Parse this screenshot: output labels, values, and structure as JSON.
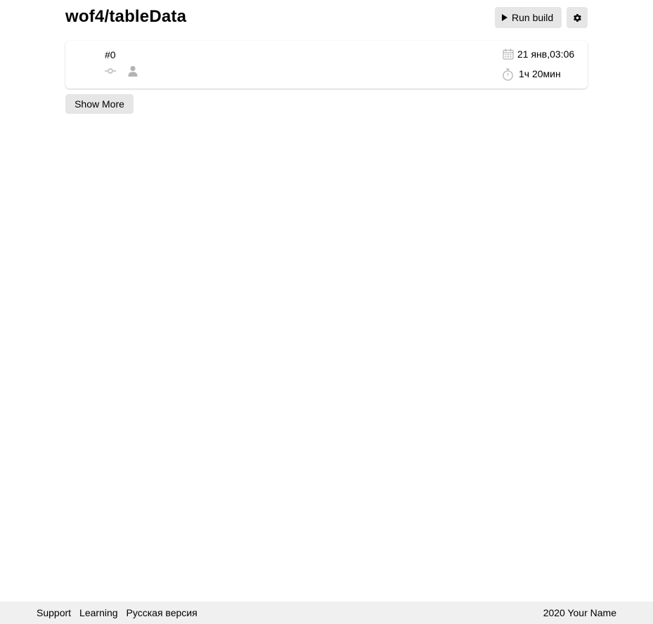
{
  "header": {
    "title": "wof4/tableData",
    "run_build_label": "Run build",
    "settings_icon": "gear-icon"
  },
  "builds": [
    {
      "number": "#0",
      "commit_icon": "commit-icon",
      "author_icon": "user-icon",
      "date": "21 янв,03:06",
      "duration": "1ч 20мин"
    }
  ],
  "actions": {
    "show_more_label": "Show More"
  },
  "footer": {
    "links": [
      "Support",
      "Learning",
      "Русская версия"
    ],
    "copyright": "2020 Your Name"
  },
  "colors": {
    "button_bg": "#e6e6e6",
    "footer_bg": "#f0f0f0",
    "icon_gray": "#b3b3b3"
  }
}
